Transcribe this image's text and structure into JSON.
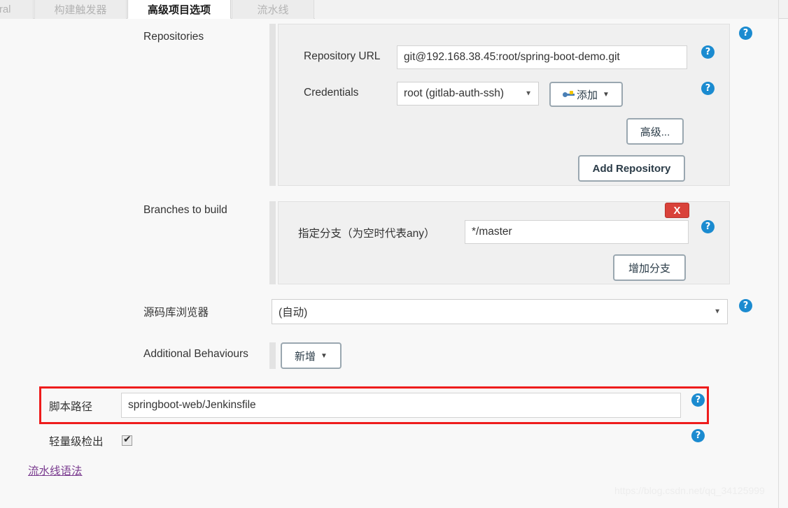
{
  "tabs": [
    {
      "label": "eral",
      "active": false
    },
    {
      "label": "构建触发器",
      "active": false
    },
    {
      "label": "高级项目选项",
      "active": true
    },
    {
      "label": "流水线",
      "active": false
    }
  ],
  "sections": {
    "repositories": {
      "label": "Repositories",
      "repository_url": {
        "label": "Repository URL",
        "value": "git@192.168.38.45:root/spring-boot-demo.git"
      },
      "credentials": {
        "label": "Credentials",
        "value": "root (gitlab-auth-ssh)",
        "add_button": "添加",
        "add_icon": "key-icon",
        "caret": "▾"
      },
      "advanced_button": "高级...",
      "add_repository_button": "Add Repository"
    },
    "branches": {
      "label": "Branches to build",
      "specifier": {
        "label": "指定分支（为空时代表any）",
        "value": "*/master"
      },
      "delete_button": "X",
      "add_branch_button": "增加分支"
    },
    "browser": {
      "label": "源码库浏览器",
      "value": "(自动)",
      "caret": "▾"
    },
    "additional_behaviours": {
      "label": "Additional Behaviours",
      "add_button": "新增",
      "caret": "▾"
    },
    "script_path": {
      "label": "脚本路径",
      "value": "springboot-web/Jenkinsfile"
    },
    "lightweight_checkout": {
      "label": "轻量级检出",
      "checked": true,
      "tick": "✔"
    },
    "pipeline_syntax_link": "流水线语法"
  },
  "help_icon_glyph": "?",
  "watermark": "https://blog.csdn.net/qq_34125999",
  "colors": {
    "accent_help": "#1b8bd0",
    "danger": "#d9423a",
    "highlight": "#ee1c1c",
    "link": "#7a3b8f",
    "page_bg": "#f8f8f8",
    "panel_bg": "#f0f0f0"
  }
}
